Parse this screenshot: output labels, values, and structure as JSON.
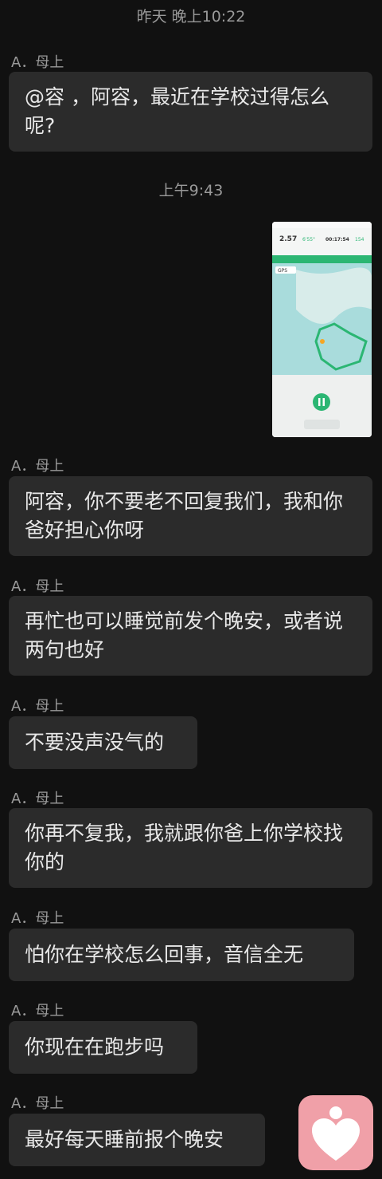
{
  "timestamps": {
    "t1": "昨天 晚上10:22",
    "t2": "上午9:43"
  },
  "sender_name": "A．母上",
  "messages": [
    {
      "text": "@容 ，阿容，最近在学校过得怎么呢?"
    },
    {
      "text": "阿容，你不要老不回复我们，我和你爸好担心你呀"
    },
    {
      "text": "再忙也可以睡觉前发个晚安，或者说两句也好"
    },
    {
      "text": "不要没声没气的"
    },
    {
      "text": "你再不复我，我就跟你爸上你学校找你的"
    },
    {
      "text": "怕你在学校怎么回事，音信全无"
    },
    {
      "text": "你现在在跑步吗"
    },
    {
      "text": "最好每天睡前报个晚安"
    }
  ],
  "shared_image": {
    "distance": "2.57",
    "pace": "6'55\"",
    "duration": "00:17:54",
    "steps": "154",
    "gps_label": "GPS"
  },
  "colors": {
    "background": "#111111",
    "bubble": "#2b2b2b",
    "accent_green": "#2bb673",
    "fab": "#f0a0a8"
  },
  "icons": {
    "fab": "heart-person-icon"
  }
}
